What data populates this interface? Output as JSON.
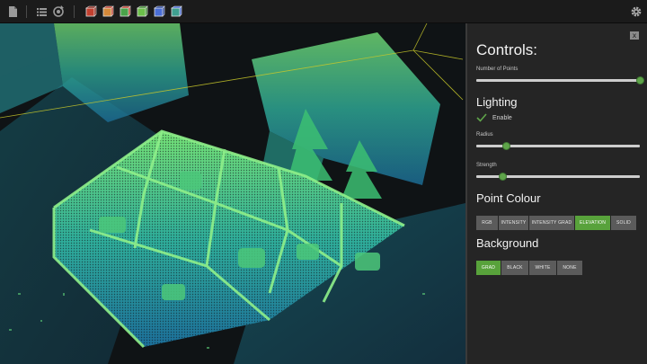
{
  "toolbar": {
    "icons": [
      "document-icon",
      "list-icon",
      "rotate-icon",
      "red-box-icon",
      "orange-box-icon",
      "red-green-box-icon",
      "green-box-icon",
      "blue-box-icon",
      "blue-green-box-icon",
      "settings-gear-icon"
    ],
    "cube_colors": {
      "red": "#c2402f",
      "orange": "#d4893a",
      "red_green": "#8f8a36",
      "green": "#4aa34a",
      "blue": "#4a6ed6",
      "teal": "#3f9f8f"
    }
  },
  "controls": {
    "title": "Controls:",
    "close_label": "x",
    "number_of_points": {
      "label": "Number of Points",
      "value": 1.0
    },
    "lighting": {
      "title": "Lighting",
      "enable_label": "Enable",
      "enabled": true,
      "radius": {
        "label": "Radius",
        "value": 0.18
      },
      "strength": {
        "label": "Strength",
        "value": 0.16
      }
    },
    "point_colour": {
      "title": "Point Colour",
      "options": [
        "RGB",
        "INTENSITY",
        "INTENSITY GRAD",
        "ELEVATION",
        "SOLID"
      ],
      "selected": "ELEVATION"
    },
    "background": {
      "title": "Background",
      "options": [
        "GRAD",
        "BLACK",
        "WHITE",
        "NONE"
      ],
      "selected": "GRAD"
    }
  },
  "colors": {
    "accent_green": "#58a23b",
    "point_low": "#1c6f9a",
    "point_high": "#74e076"
  }
}
